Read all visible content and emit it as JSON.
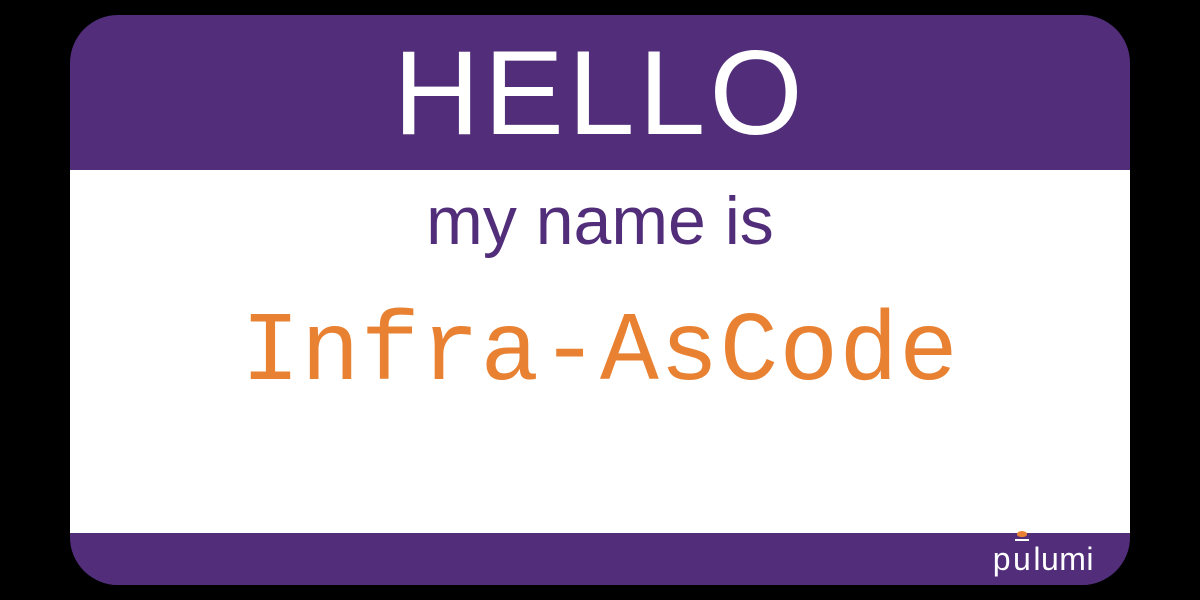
{
  "nametag": {
    "hello_label": "HELLO",
    "subtitle": "my name is",
    "name_value": "Infra-AsCode"
  },
  "logo": {
    "brand": "pulumi"
  },
  "colors": {
    "purple": "#512D7A",
    "orange": "#E98132",
    "white": "#FFFFFF",
    "black": "#000000"
  }
}
